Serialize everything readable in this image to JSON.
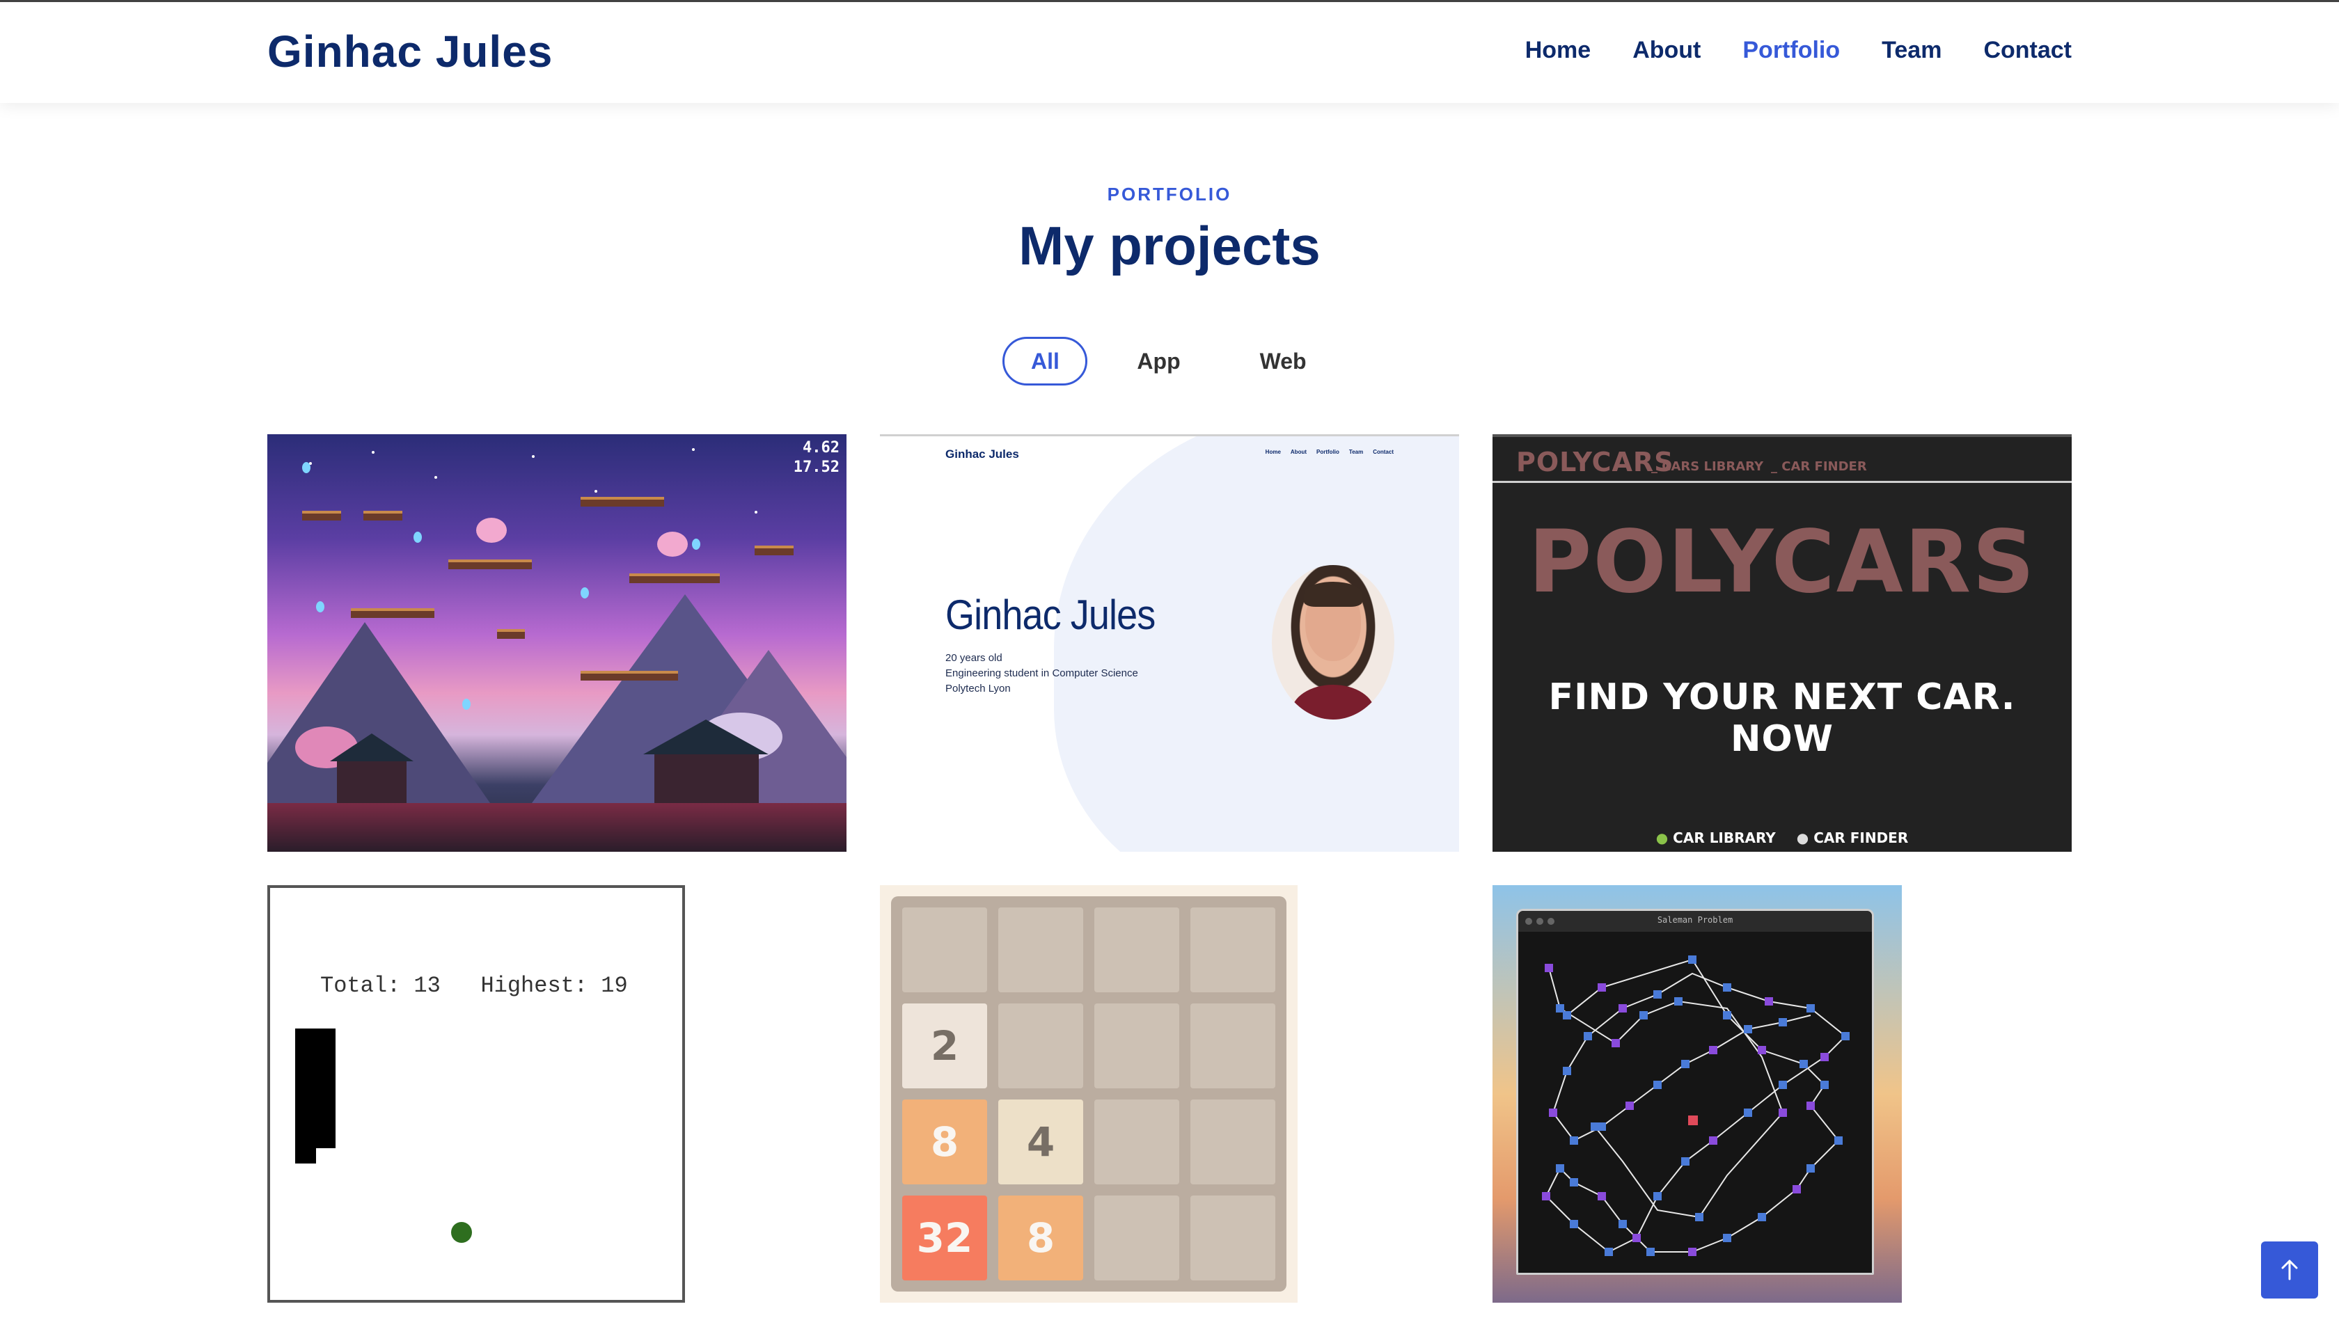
{
  "header": {
    "logo": "Ginhac Jules",
    "nav": [
      "Home",
      "About",
      "Portfolio",
      "Team",
      "Contact"
    ],
    "active_nav": "Portfolio"
  },
  "portfolio": {
    "subtitle": "PORTFOLIO",
    "title": "My projects",
    "filters": [
      "All",
      "App",
      "Web"
    ],
    "active_filter": "All"
  },
  "projects": {
    "game": {
      "hud_line1": "4.62",
      "hud_line2": "17.52"
    },
    "website": {
      "logo": "Ginhac Jules",
      "nav": [
        "Home",
        "About",
        "Portfolio",
        "Team",
        "Contact"
      ],
      "name": "Ginhac Jules",
      "line1": "20 years old",
      "line2": "Engineering student in Computer Science",
      "line3": "Polytech Lyon"
    },
    "polycars": {
      "brand": "POLYCARS",
      "nav1": "_ CARS LIBRARY",
      "nav2": "_ CAR FINDER",
      "headline": "POLYCARS",
      "cta": "FIND YOUR NEXT CAR. NOW",
      "footer1": "CAR LIBRARY",
      "footer2": "CAR FINDER"
    },
    "pong": {
      "score": "Total: 13   Highest: 19"
    },
    "game2048": {
      "tiles": [
        "",
        "",
        "",
        "",
        "2",
        "",
        "",
        "",
        "8",
        "4",
        "",
        "",
        "32",
        "8",
        "",
        ""
      ]
    },
    "salesman": {
      "title": "Saleman Problem"
    }
  },
  "colors": {
    "navy": "#0d2a6b",
    "accent": "#3659d8"
  },
  "icons": {
    "to_top": "arrow-up-icon"
  }
}
